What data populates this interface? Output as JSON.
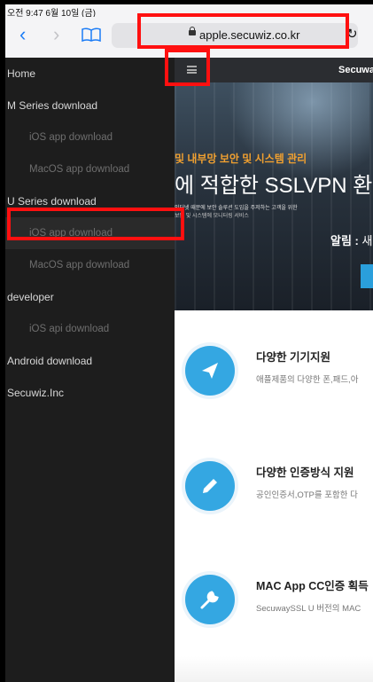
{
  "status": {
    "time": "오전 9:47  6월 10일 (금)"
  },
  "toolbar": {
    "back_glyph": "‹",
    "forward_glyph": "›",
    "url": "apple.secuwiz.co.kr",
    "reload_glyph": "↻"
  },
  "sidebar": {
    "items": [
      {
        "label": "Home"
      },
      {
        "label": "M Series download"
      },
      {
        "label": "iOS app download"
      },
      {
        "label": "MacOS app download"
      },
      {
        "label": "U Series download"
      },
      {
        "label": "iOS app download"
      },
      {
        "label": "MacOS app download"
      },
      {
        "label": "developer"
      },
      {
        "label": "iOS api download"
      },
      {
        "label": "Android download"
      },
      {
        "label": "Secuwiz.Inc"
      }
    ]
  },
  "main": {
    "brand": "Secuway",
    "hero": {
      "line1": "및 내부망 보안 및 시스템 관리",
      "line2": "에 적합한 SSLVPN 환경",
      "line3": "인터넷 때문에 보안 솔루션 도입을 주저하는 고객을 위한",
      "line4": "보안 및 시스템에 모니터링 서비스",
      "notice_label": "알림 :",
      "notice_text": " 새로운"
    },
    "features": [
      {
        "title": "다양한 기기지원",
        "desc": "애플제품의 다양한 폰,패드,아"
      },
      {
        "title": "다양한 인증방식 지원",
        "desc": "공인인증서,OTP를 포함한 다"
      },
      {
        "title": "MAC App CC인증 획득",
        "desc": "SecuwaySSL U 버전의 MAC"
      }
    ]
  },
  "colors": {
    "accent": "#1b7cf6",
    "feature_blue": "#34a7e2",
    "highlight": "#ff1010",
    "sidebar_bg": "#1d1d1d"
  }
}
